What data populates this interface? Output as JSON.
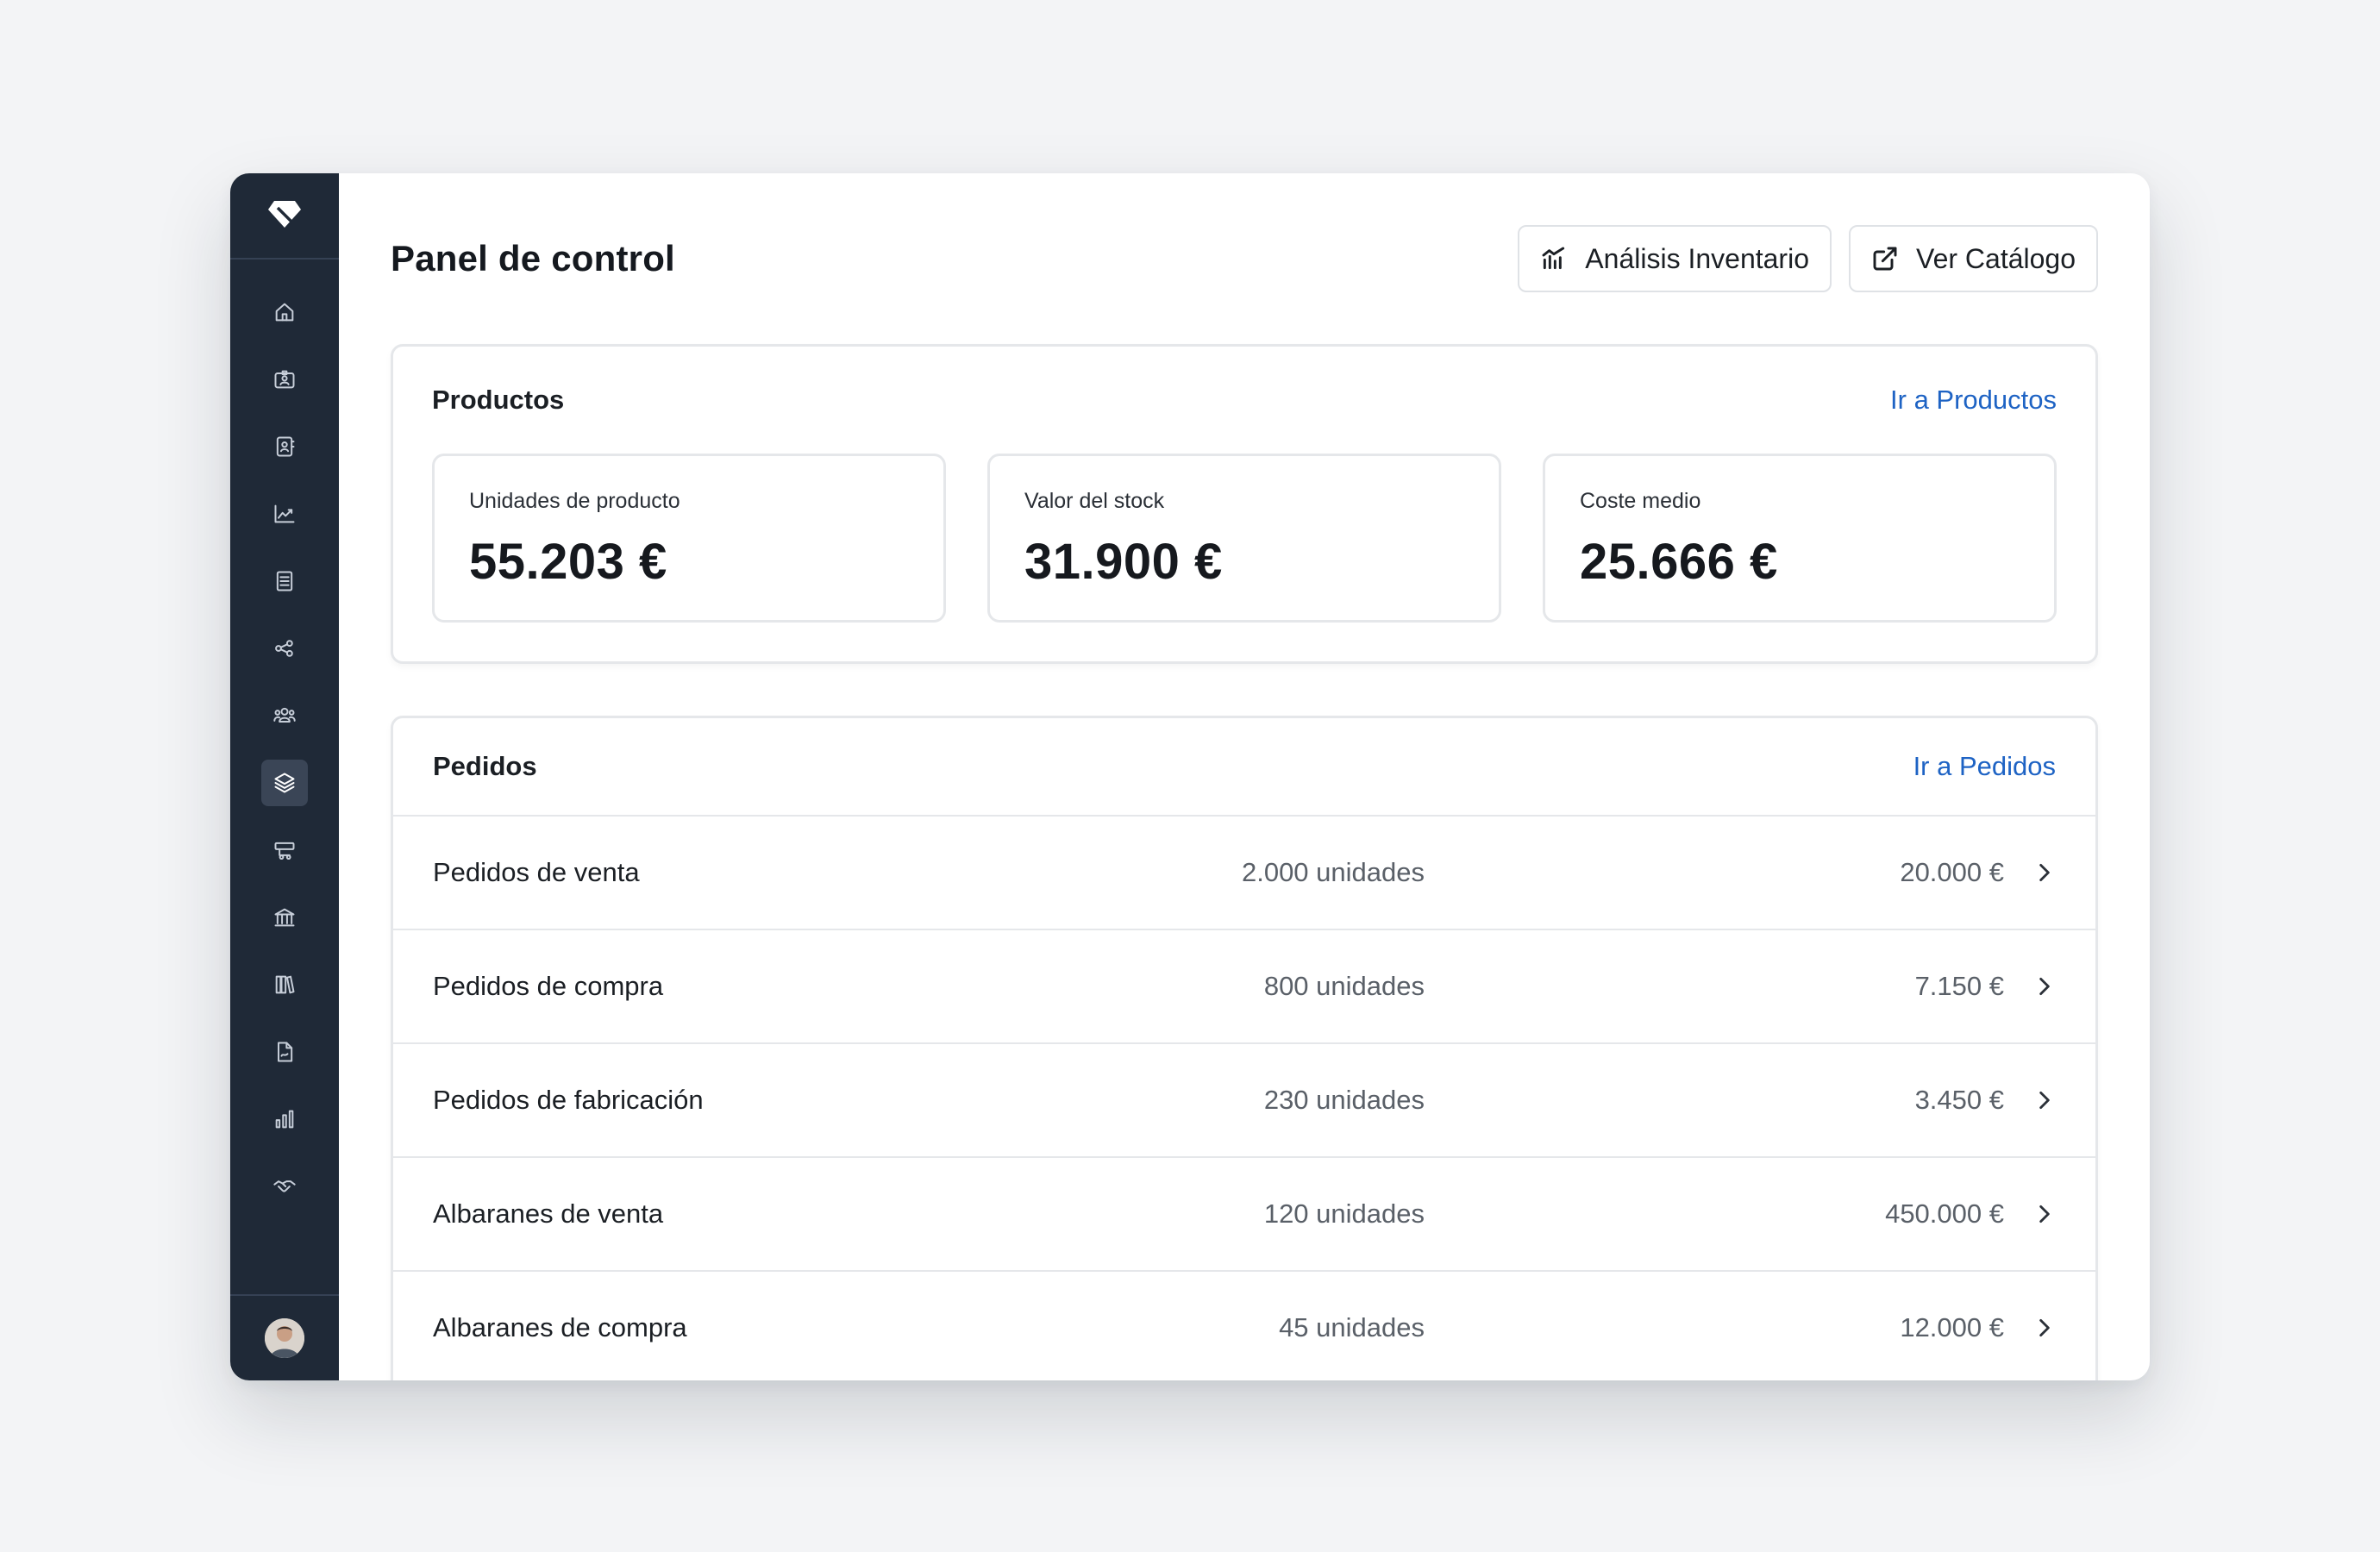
{
  "app": {
    "sidebar": {
      "logo_icon": "diamond-logo-icon",
      "items": [
        {
          "icon": "home-icon"
        },
        {
          "icon": "id-card-icon"
        },
        {
          "icon": "contacts-icon"
        },
        {
          "icon": "trend-chart-icon"
        },
        {
          "icon": "document-list-icon"
        },
        {
          "icon": "share-nodes-icon"
        },
        {
          "icon": "team-icon"
        },
        {
          "icon": "layers-icon",
          "active": true
        },
        {
          "icon": "shipping-icon"
        },
        {
          "icon": "bank-icon"
        },
        {
          "icon": "library-icon"
        },
        {
          "icon": "invoice-icon"
        },
        {
          "icon": "bar-chart-icon"
        },
        {
          "icon": "handshake-icon"
        }
      ],
      "avatar_icon": "user-avatar"
    },
    "colors": {
      "sidebar_bg": "#1f2937",
      "link": "#1e63c4",
      "background": "#f3f4f6"
    }
  },
  "header": {
    "title": "Panel de control",
    "buttons": {
      "inventory_analysis": "Análisis Inventario",
      "view_catalog": "Ver Catálogo"
    }
  },
  "products": {
    "title": "Productos",
    "link": "Ir a Productos",
    "stats": [
      {
        "label": "Unidades de producto",
        "value": "55.203 €"
      },
      {
        "label": "Valor del stock",
        "value": "31.900 €"
      },
      {
        "label": "Coste medio",
        "value": "25.666 €"
      }
    ]
  },
  "orders": {
    "title": "Pedidos",
    "link": "Ir a Pedidos",
    "rows": [
      {
        "name": "Pedidos de venta",
        "units": "2.000 unidades",
        "value": "20.000 €"
      },
      {
        "name": "Pedidos de compra",
        "units": "800 unidades",
        "value": "7.150 €"
      },
      {
        "name": "Pedidos de fabricación",
        "units": "230 unidades",
        "value": "3.450 €"
      },
      {
        "name": "Albaranes de venta",
        "units": "120 unidades",
        "value": "450.000 €"
      },
      {
        "name": "Albaranes de compra",
        "units": "45 unidades",
        "value": "12.000 €"
      }
    ]
  }
}
